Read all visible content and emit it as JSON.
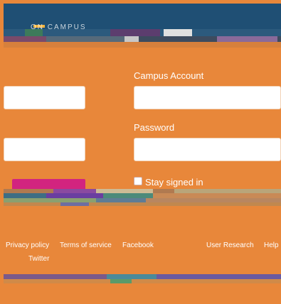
{
  "header": {
    "logo_text": "ON CAMPUS"
  },
  "login": {
    "campus_account_label": "Campus Account",
    "password_label": "Password",
    "stay_signed_in_label": "Stay signed in",
    "stay_signed_in_checked": false
  },
  "footer": {
    "links": [
      "Privacy policy",
      "Terms of service",
      "Facebook",
      "User Research",
      "Help",
      "Twitter"
    ]
  },
  "colors": {
    "background": "#E8873A",
    "header": "#1F4F74",
    "sign_in_button": "#D2247F"
  }
}
